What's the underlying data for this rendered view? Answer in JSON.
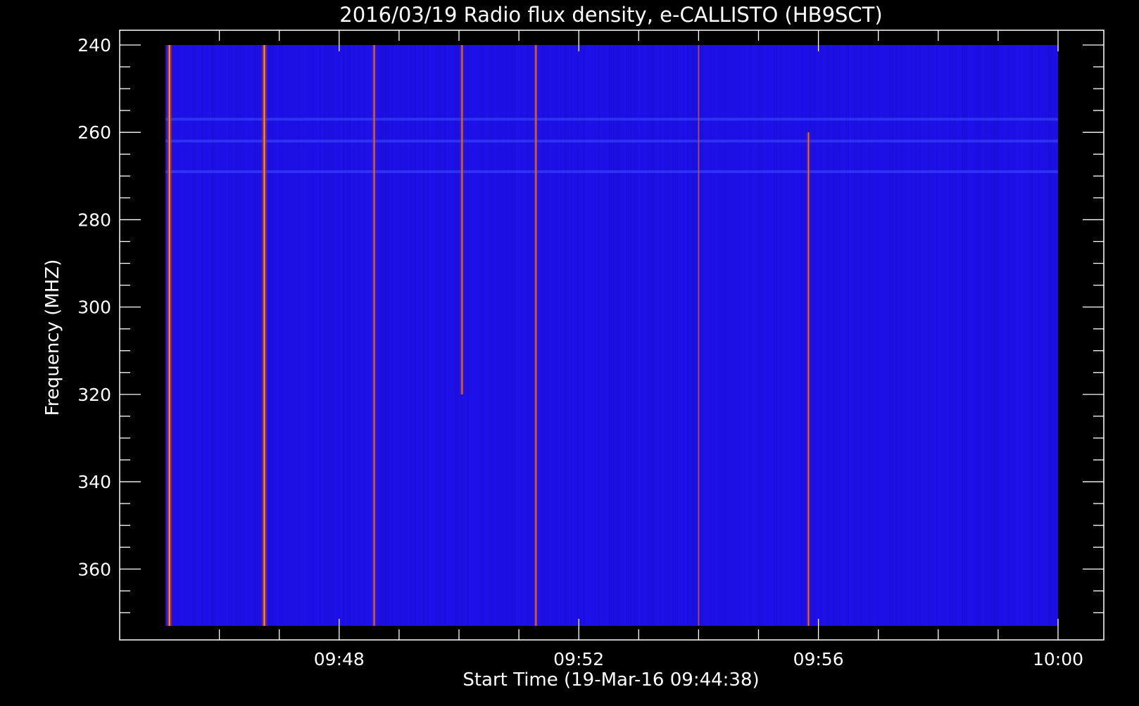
{
  "chart_data": {
    "type": "heatmap",
    "title": "2016/03/19  Radio flux density, e-CALLISTO (HB9SCT)",
    "xlabel": "Start Time (19-Mar-16 09:44:38)",
    "ylabel": "Frequency (MHZ)",
    "y_inverted": true,
    "grid": false,
    "legend": "none",
    "xlim": [
      "09:45:06",
      "10:00:00"
    ],
    "ylim": [
      240,
      373
    ],
    "x_ticks": [
      "09:48",
      "09:52",
      "09:56",
      "10:00"
    ],
    "y_ticks": [
      "240",
      "260",
      "280",
      "300",
      "320",
      "340",
      "360"
    ],
    "colors": {
      "background": "#000000",
      "spectrum_base": "#1c10e6",
      "burst_core": "#ffd23c",
      "burst_edge": "#c8321e"
    },
    "bursts": [
      {
        "time": "09:45:10",
        "freq_range": [
          240,
          373
        ],
        "intensity": "high"
      },
      {
        "time": "09:46:45",
        "freq_range": [
          240,
          373
        ],
        "intensity": "high"
      },
      {
        "time": "09:48:35",
        "freq_range": [
          240,
          373
        ],
        "intensity": "medium"
      },
      {
        "time": "09:50:03",
        "freq_range": [
          240,
          320
        ],
        "intensity": "medium"
      },
      {
        "time": "09:51:17",
        "freq_range": [
          240,
          373
        ],
        "intensity": "medium"
      },
      {
        "time": "09:54:00",
        "freq_range": [
          240,
          373
        ],
        "intensity": "low"
      },
      {
        "time": "09:55:50",
        "freq_range": [
          260,
          373
        ],
        "intensity": "medium"
      }
    ],
    "horizontal_bands_mhz": [
      257,
      262,
      269
    ]
  }
}
